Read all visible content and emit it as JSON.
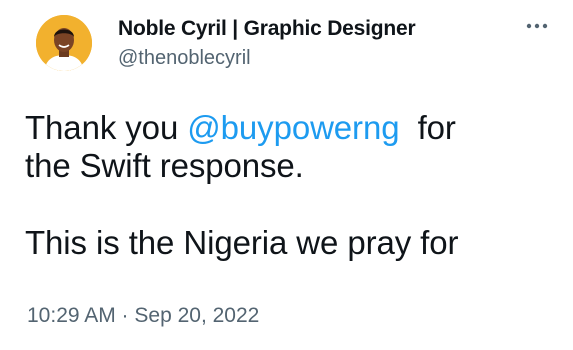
{
  "author": {
    "display_name": "Noble Cyril | Graphic Designer",
    "handle": "@thenoblecyril",
    "avatar_icon": "avatar-photo"
  },
  "more_icon": "ellipsis-icon",
  "tweet": {
    "line1_before": "Thank you ",
    "mention": "@buypowerng",
    "line1_after": "  for",
    "line2": "the Swift response.",
    "line3": "This is the Nigeria we pray for"
  },
  "timestamp": "10:29 AM · Sep 20, 2022",
  "colors": {
    "text": "#0f1419",
    "secondary": "#536471",
    "link": "#1d9bf0",
    "avatar_bg": "#f2b12e"
  }
}
